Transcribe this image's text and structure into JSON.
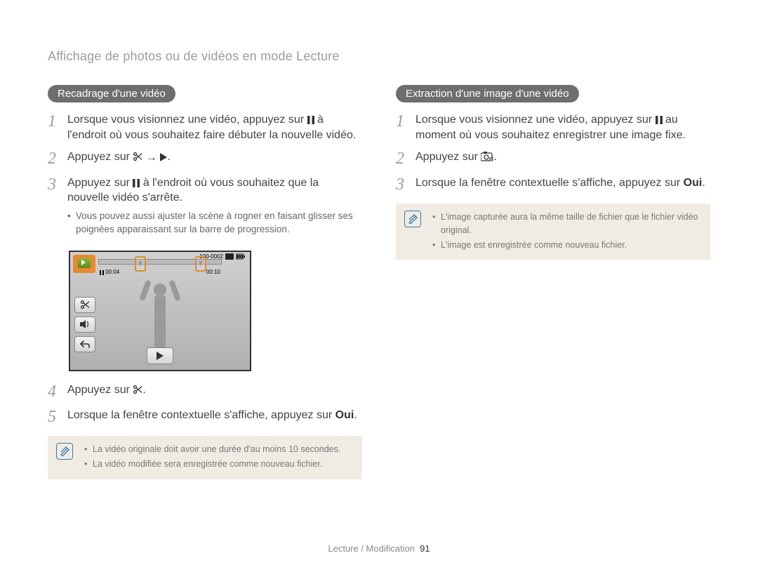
{
  "header": "Affichage de photos ou de vidéos en mode Lecture",
  "left": {
    "pill": "Recadrage d'une vidéo",
    "steps": {
      "s1_a": "Lorsque vous visionnez une vidéo, appuyez sur ",
      "s1_b": " à l'endroit où vous souhaitez faire débuter la nouvelle vidéo.",
      "s2_a": "Appuyez sur ",
      "s2_b": ".",
      "s3_a": "Appuyez sur ",
      "s3_b": " à l'endroit où vous souhaitez que la nouvelle vidéo s'arrête.",
      "s3_bullet": "Vous pouvez aussi ajuster la scène à rogner en faisant glisser ses poignées apparaissant sur la barre de progression.",
      "s4_a": "Appuyez sur ",
      "s4_b": ".",
      "s5_a": "Lorsque la fenêtre contextuelle s'affiche, appuyez sur ",
      "s5_b": "Oui",
      "s5_c": "."
    },
    "screenshot": {
      "file": "100-0002",
      "time_left": "00:04",
      "time_right": "00:10"
    },
    "note": {
      "n1": "La vidéo originale doit avoir une durée d'au moins 10 secondes.",
      "n2": "La vidéo modifiée sera enregistrée comme nouveau fichier."
    }
  },
  "right": {
    "pill": "Extraction d'une image d'une vidéo",
    "steps": {
      "s1_a": "Lorsque vous visionnez une vidéo, appuyez sur ",
      "s1_b": " au moment où vous souhaitez enregistrer une image fixe.",
      "s2_a": "Appuyez sur ",
      "s2_b": ".",
      "s3_a": "Lorsque la fenêtre contextuelle s'affiche, appuyez sur ",
      "s3_b": "Oui",
      "s3_c": "."
    },
    "note": {
      "n1": "L'image capturée aura la même taille de fichier que le fichier vidéo original.",
      "n2": "L'image est enregistrée comme nouveau fichier."
    }
  },
  "footer": {
    "section": "Lecture / Modification",
    "page": "91"
  }
}
